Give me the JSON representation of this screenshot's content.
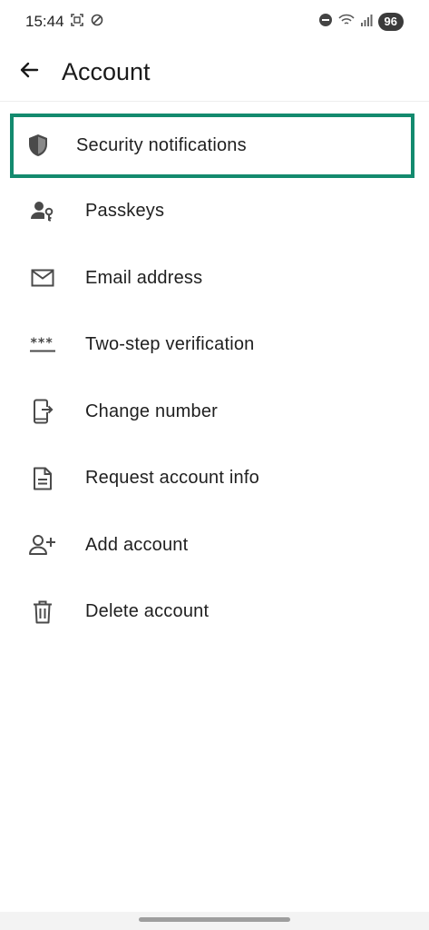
{
  "status_bar": {
    "time": "15:44",
    "battery": "96",
    "icons": [
      "screenshot-icon",
      "sync-icon",
      "dnd-icon",
      "wifi-icon",
      "signal-icon"
    ]
  },
  "app_bar": {
    "title": "Account",
    "back_icon": "arrow-back-icon"
  },
  "menu": {
    "items": [
      {
        "label": "Security notifications",
        "icon": "shield-icon",
        "highlighted": true
      },
      {
        "label": "Passkeys",
        "icon": "person-key-icon"
      },
      {
        "label": "Email address",
        "icon": "mail-icon"
      },
      {
        "label": "Two-step verification",
        "icon": "password-dots-icon"
      },
      {
        "label": "Change number",
        "icon": "phone-transfer-icon"
      },
      {
        "label": "Request account info",
        "icon": "document-icon"
      },
      {
        "label": "Add account",
        "icon": "person-add-icon"
      },
      {
        "label": "Delete account",
        "icon": "trash-icon"
      }
    ]
  },
  "colors": {
    "highlight_border": "#138a6e",
    "icon": "#4a4a4a",
    "text": "#1f1f1f"
  }
}
